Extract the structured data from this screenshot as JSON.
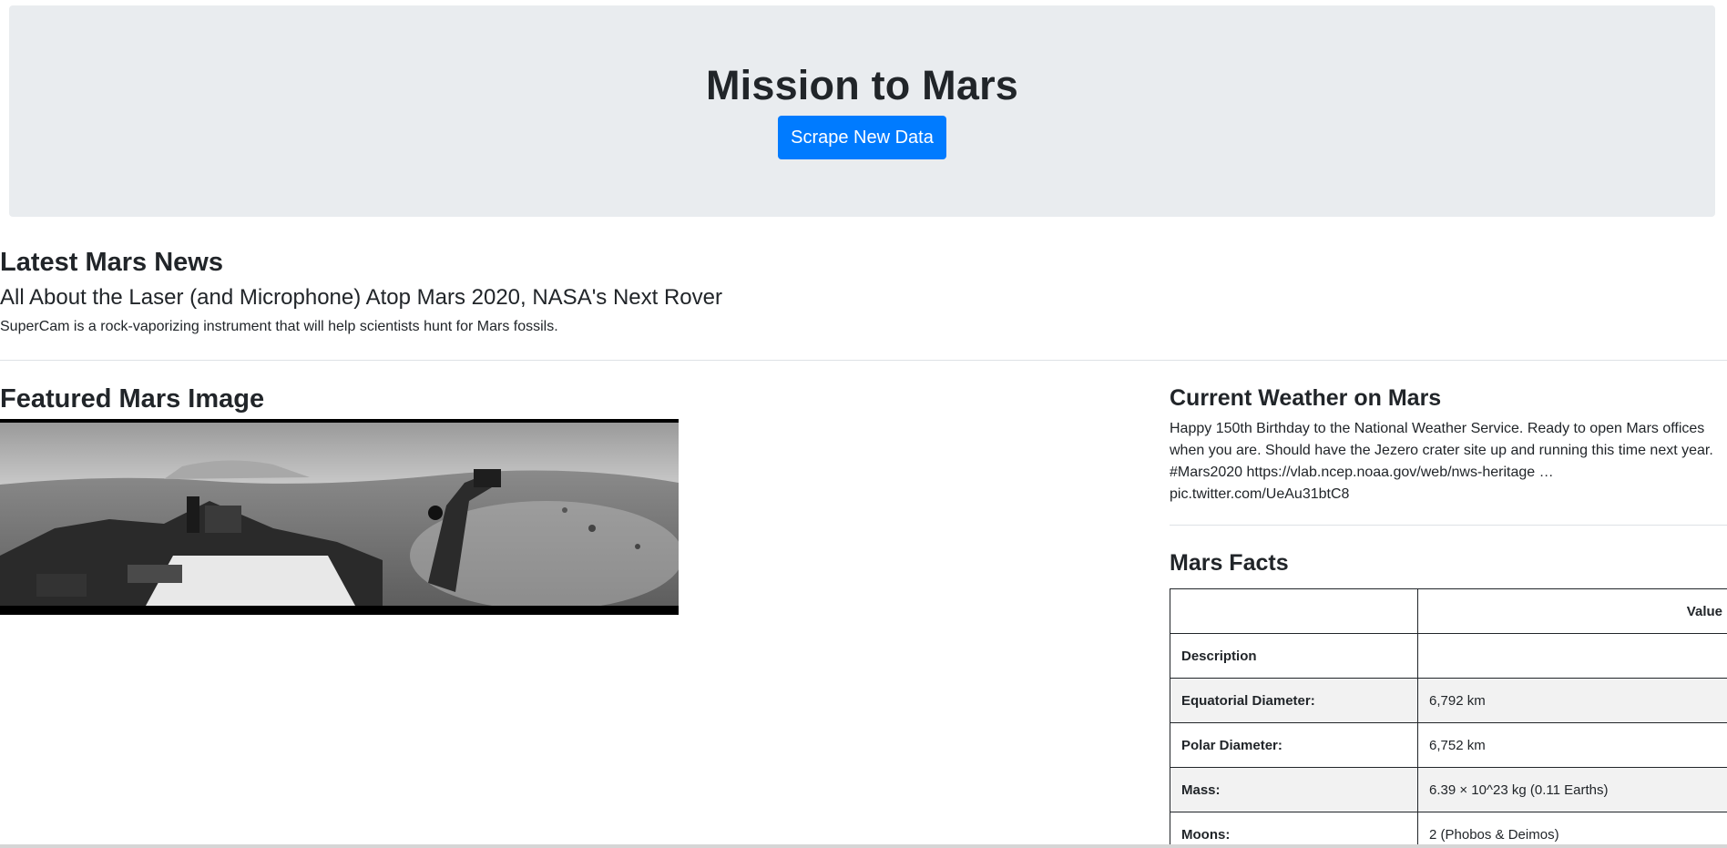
{
  "header": {
    "title": "Mission to Mars",
    "scrape_button_label": "Scrape New Data"
  },
  "news": {
    "heading": "Latest Mars News",
    "title": "All About the Laser (and Microphone) Atop Mars 2020, NASA's Next Rover",
    "teaser": "SuperCam is a rock-vaporizing instrument that will help scientists hunt for Mars fossils."
  },
  "featured_image": {
    "heading": "Featured Mars Image",
    "alt_icon": "mars-panorama-image"
  },
  "weather": {
    "heading": "Current Weather on Mars",
    "text": "Happy 150th Birthday to the National Weather Service. Ready to open Mars offices when you are. Should have the Jezero crater site up and running this time next year. #Mars2020 https://vlab.ncep.noaa.gov/web/nws-heritage … pic.twitter.com/UeAu31btC8"
  },
  "facts": {
    "heading": "Mars Facts",
    "columns": [
      "",
      "Value"
    ],
    "rows": [
      {
        "label": "Description",
        "value": ""
      },
      {
        "label": "Equatorial Diameter:",
        "value": "6,792 km"
      },
      {
        "label": "Polar Diameter:",
        "value": "6,752 km"
      },
      {
        "label": "Mass:",
        "value": "6.39 × 10^23 kg (0.11 Earths)"
      },
      {
        "label": "Moons:",
        "value": "2 (Phobos & Deimos)"
      }
    ]
  },
  "colors": {
    "jumbotron_bg": "#e9ecef",
    "button_primary": "#007bff",
    "text": "#212529",
    "stripe": "#f2f2f2"
  }
}
